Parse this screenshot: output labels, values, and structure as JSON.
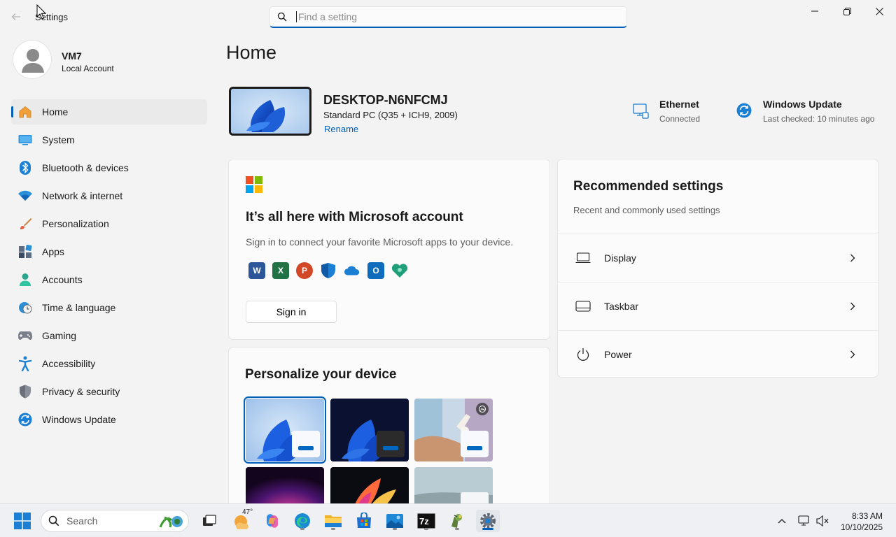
{
  "window": {
    "title": "Settings",
    "back_icon": "arrow-left-icon",
    "search_placeholder": "Find a setting",
    "controls": [
      "minimize-icon",
      "restore-icon",
      "close-icon"
    ]
  },
  "profile": {
    "name": "VM7",
    "account_type": "Local Account"
  },
  "sidebar": {
    "items": [
      {
        "label": "Home",
        "icon": "home-icon",
        "active": true
      },
      {
        "label": "System",
        "icon": "system-icon"
      },
      {
        "label": "Bluetooth & devices",
        "icon": "bluetooth-icon"
      },
      {
        "label": "Network & internet",
        "icon": "wifi-icon"
      },
      {
        "label": "Personalization",
        "icon": "brush-icon"
      },
      {
        "label": "Apps",
        "icon": "apps-icon"
      },
      {
        "label": "Accounts",
        "icon": "person-icon"
      },
      {
        "label": "Time & language",
        "icon": "clock-globe-icon"
      },
      {
        "label": "Gaming",
        "icon": "gamepad-icon"
      },
      {
        "label": "Accessibility",
        "icon": "accessibility-icon"
      },
      {
        "label": "Privacy & security",
        "icon": "shield-icon"
      },
      {
        "label": "Windows Update",
        "icon": "update-icon"
      }
    ]
  },
  "main": {
    "title": "Home",
    "device": {
      "name": "DESKTOP-N6NFCMJ",
      "spec": "Standard PC (Q35 + ICH9, 2009)",
      "rename": "Rename"
    },
    "status": [
      {
        "title": "Ethernet",
        "subtitle": "Connected",
        "icon": "ethernet-icon"
      },
      {
        "title": "Windows Update",
        "subtitle": "Last checked: 10 minutes ago",
        "icon": "update-icon"
      }
    ],
    "ms_card": {
      "title": "It’s all here with Microsoft account",
      "description": "Sign in to connect your favorite Microsoft apps to your device.",
      "apps": [
        "word-icon",
        "excel-icon",
        "powerpoint-icon",
        "defender-icon",
        "onedrive-icon",
        "outlook-icon",
        "family-icon"
      ],
      "signin_label": "Sign in"
    },
    "personalize": {
      "title": "Personalize your device",
      "themes": [
        "windows-light",
        "windows-dark",
        "captured-motion",
        "glow",
        "flow",
        "sunrise"
      ]
    },
    "recommended": {
      "title": "Recommended settings",
      "subtitle": "Recent and commonly used settings",
      "items": [
        {
          "label": "Display",
          "icon": "display-icon"
        },
        {
          "label": "Taskbar",
          "icon": "taskbar-icon"
        },
        {
          "label": "Power",
          "icon": "power-icon"
        }
      ]
    }
  },
  "taskbar": {
    "search_label": "Search",
    "weather_temp": "47°",
    "apps": [
      "task-view-icon",
      "weather-icon",
      "copilot-icon",
      "edge-icon",
      "file-explorer-icon",
      "store-icon",
      "photos-icon",
      "7zip-icon",
      "app-icon",
      "settings-icon"
    ],
    "time": "8:33 AM",
    "date": "10/10/2025"
  },
  "colors": {
    "accent": "#005fb8",
    "background": "#f3f3f3",
    "card": "#fbfbfb"
  }
}
